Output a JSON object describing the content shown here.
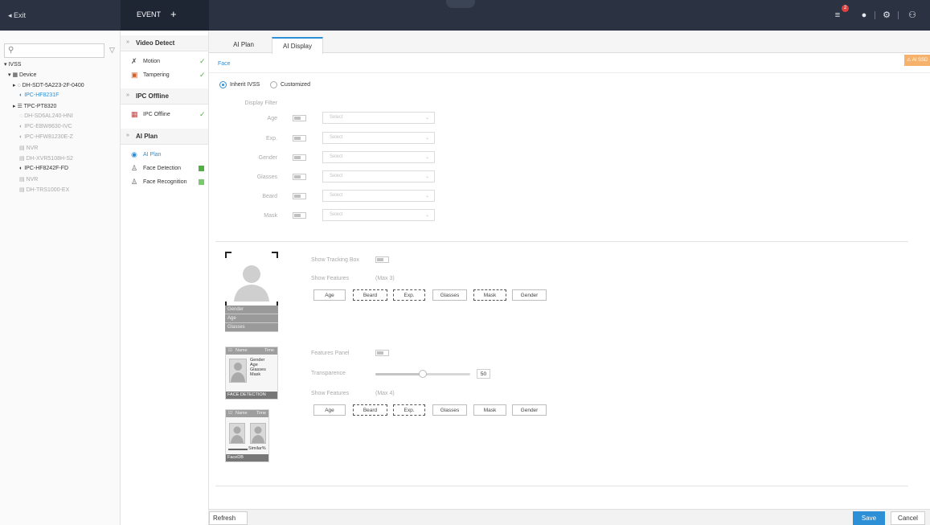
{
  "topbar": {
    "exit_label": "Exit",
    "event_label": "EVENT",
    "add_label": "+",
    "alarm_count": "2"
  },
  "tree": {
    "items": [
      {
        "label": "IVSS"
      },
      {
        "label": "Device"
      },
      {
        "label": "DH-SDT-5A223-2F-0400"
      },
      {
        "label": "IPC-HF8231F"
      },
      {
        "label": "TPC-PT8320"
      },
      {
        "label": "DH-SD6AL240-HNI"
      },
      {
        "label": "IPC-EBW8630-IVC"
      },
      {
        "label": "IPC-HFW81230E-Z"
      },
      {
        "label": "NVR"
      },
      {
        "label": "DH-XVR5108H-S2"
      },
      {
        "label": "IPC-HF8242F-FD"
      },
      {
        "label": "NVR"
      },
      {
        "label": "DH-TRS1000-EX"
      }
    ]
  },
  "events": {
    "groups": [
      {
        "title": "Video Detect",
        "items": [
          {
            "label": "Motion"
          },
          {
            "label": "Tampering"
          }
        ]
      },
      {
        "title": "IPC Offline",
        "items": [
          {
            "label": "IPC Offline"
          }
        ]
      },
      {
        "title": "AI Plan",
        "items": [
          {
            "label": "AI Plan"
          },
          {
            "label": "Face Detection"
          },
          {
            "label": "Face Recognition"
          }
        ]
      }
    ]
  },
  "main": {
    "tabs": [
      {
        "label": "AI Plan"
      },
      {
        "label": "AI Display"
      }
    ],
    "sub_tab": "Face",
    "warning_text": "AI SSD",
    "inherit_label": "Inherit IVSS",
    "custom_label": "Customized",
    "display_filter_label": "Display Filter",
    "filters": [
      {
        "label": "Age",
        "placeholder": "Select"
      },
      {
        "label": "Exp.",
        "placeholder": "Select"
      },
      {
        "label": "Gender",
        "placeholder": "Select"
      },
      {
        "label": "Glasses",
        "placeholder": "Select"
      },
      {
        "label": "Beard",
        "placeholder": "Select"
      },
      {
        "label": "Mask",
        "placeholder": "Select"
      }
    ],
    "tracking": {
      "show_tracking_label": "Show Tracking Box",
      "show_features_label": "Show Features",
      "max_label": "(Max 3)",
      "preview_bars": [
        "Gender",
        "Age",
        "Glasses"
      ],
      "chips": [
        "Age",
        "Beard",
        "Exp.",
        "Glasses",
        "Mask",
        "Gender"
      ]
    },
    "panel": {
      "features_panel_label": "Features Panel",
      "transparence_label": "Transparence",
      "transparence_value": "50",
      "show_features_label": "Show Features",
      "max_label": "(Max 4)",
      "chips": [
        "Age",
        "Beard",
        "Exp.",
        "Glasses",
        "Mask",
        "Gender"
      ],
      "card1_head_name": "Name",
      "card1_head_time": "Time",
      "card1_lines": [
        "Gender",
        "Age",
        "Glasses",
        "Mask"
      ],
      "card1_foot": "FACE DETECTION",
      "card2_head_name": "Name",
      "card2_head_time": "Time",
      "card2_similar": "Similar%",
      "card2_foot": "FaceDB"
    },
    "refresh_label": "Refresh",
    "save_label": "Save",
    "cancel_label": "Cancel"
  }
}
